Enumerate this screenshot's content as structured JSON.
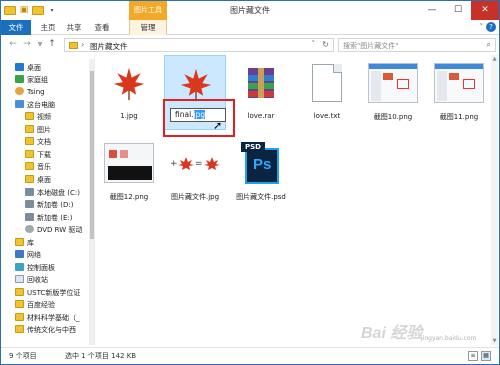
{
  "window": {
    "title": "图片藏文件",
    "tool_tab": "图片工具",
    "controls": {
      "minimize": "—",
      "maximize": "☐",
      "close": "✕"
    }
  },
  "ribbon": {
    "tabs": [
      "文件",
      "主页",
      "共享",
      "查看",
      "管理"
    ],
    "chevron": "˅",
    "help": "?"
  },
  "address": {
    "path": "图片藏文件",
    "separator": "›",
    "search_placeholder": "搜索\"图片藏文件\"",
    "back": "←",
    "forward": "→",
    "up": "↑"
  },
  "nav_pane": {
    "items": [
      {
        "label": "桌面",
        "icon": "favorites-star-icon"
      },
      {
        "label": "家庭组",
        "icon": "homegroup-icon"
      },
      {
        "label": "Tsing",
        "icon": "user-icon"
      },
      {
        "label": "这台电脑",
        "icon": "computer-icon"
      },
      {
        "label": "视频",
        "icon": "folder-icon"
      },
      {
        "label": "图片",
        "icon": "folder-icon"
      },
      {
        "label": "文档",
        "icon": "folder-icon"
      },
      {
        "label": "下载",
        "icon": "folder-icon"
      },
      {
        "label": "音乐",
        "icon": "folder-icon"
      },
      {
        "label": "桌面",
        "icon": "folder-icon"
      },
      {
        "label": "本地磁盘 (C:)",
        "icon": "drive-icon"
      },
      {
        "label": "新加卷 (D:)",
        "icon": "drive-icon"
      },
      {
        "label": "新加卷 (E:)",
        "icon": "drive-icon"
      },
      {
        "label": "DVD RW 驱动",
        "icon": "disc-icon"
      },
      {
        "label": "库",
        "icon": "library-icon"
      },
      {
        "label": "网络",
        "icon": "network-icon"
      },
      {
        "label": "控制面板",
        "icon": "control-panel-icon"
      },
      {
        "label": "回收站",
        "icon": "recycle-bin-icon"
      },
      {
        "label": "USTC新版学位证",
        "icon": "folder-icon"
      },
      {
        "label": "百度经验",
        "icon": "folder-icon"
      },
      {
        "label": "材料科学基础（_",
        "icon": "folder-icon"
      },
      {
        "label": "传统文化与中西",
        "icon": "folder-icon"
      }
    ]
  },
  "files": [
    {
      "name": "1.jpg",
      "kind": "leaf"
    },
    {
      "name": "final.jpg",
      "kind": "leaf",
      "renaming": true,
      "rename_plain": "final.",
      "rename_selected": "jpg"
    },
    {
      "name": "love.rar",
      "kind": "rar"
    },
    {
      "name": "love.txt",
      "kind": "txt"
    },
    {
      "name": "截图10.png",
      "kind": "shot"
    },
    {
      "name": "截图11.png",
      "kind": "shot"
    },
    {
      "name": "截图12.png",
      "kind": "shot2"
    },
    {
      "name": "图片藏文件.jpg",
      "kind": "combo"
    },
    {
      "name": "图片藏文件.psd",
      "kind": "psd",
      "badge": "PSD",
      "mark": "Ps"
    }
  ],
  "status": {
    "count": "9 个项目",
    "selection": "选中 1 个项目  142 KB"
  },
  "watermark": {
    "main": "Bai 经验",
    "sub": "jingyan.baidu.com"
  },
  "colors": {
    "accent": "#1b6fbf",
    "tool_tab": "#f3a928",
    "selection": "#cce8ff",
    "highlight_box": "#e02020"
  }
}
